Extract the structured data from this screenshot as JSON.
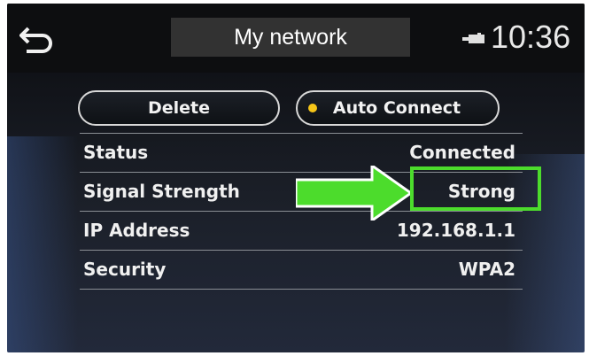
{
  "header": {
    "title": "My network",
    "clock": "10:36",
    "back_icon": "back-arrow-icon",
    "status_icon": "battery-icon"
  },
  "actions": {
    "delete_label": "Delete",
    "auto_connect_label": "Auto Connect",
    "auto_connect_indicator_color": "#f5c518"
  },
  "details": [
    {
      "label": "Status",
      "value": "Connected"
    },
    {
      "label": "Signal Strength",
      "value": "Strong"
    },
    {
      "label": "IP Address",
      "value": "192.168.1.1"
    },
    {
      "label": "Security",
      "value": "WPA2"
    }
  ],
  "annotation": {
    "color": "#4cdc2c",
    "icon": "right-arrow-icon",
    "highlighted_row": "Signal Strength"
  }
}
